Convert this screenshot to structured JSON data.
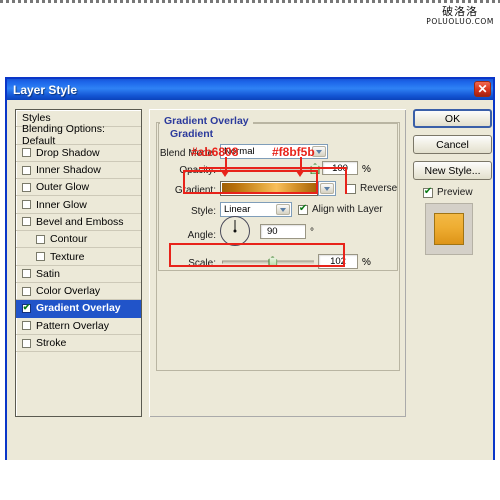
{
  "watermark": {
    "cn": "破洛洛",
    "en": "POLUOLUO.COM"
  },
  "dialog": {
    "title": "Layer Style",
    "close_icon": "close-icon"
  },
  "styles_list": [
    {
      "label": "Styles",
      "type": "header",
      "checked": false
    },
    {
      "label": "Blending Options: Default",
      "type": "header",
      "checked": false
    },
    {
      "label": "Drop Shadow",
      "type": "check",
      "checked": false
    },
    {
      "label": "Inner Shadow",
      "type": "check",
      "checked": false
    },
    {
      "label": "Outer Glow",
      "type": "check",
      "checked": false
    },
    {
      "label": "Inner Glow",
      "type": "check",
      "checked": false
    },
    {
      "label": "Bevel and Emboss",
      "type": "check",
      "checked": false
    },
    {
      "label": "Contour",
      "type": "subcheck",
      "checked": false
    },
    {
      "label": "Texture",
      "type": "subcheck",
      "checked": false
    },
    {
      "label": "Satin",
      "type": "check",
      "checked": false
    },
    {
      "label": "Color Overlay",
      "type": "check",
      "checked": false
    },
    {
      "label": "Gradient Overlay",
      "type": "check",
      "checked": true,
      "selected": true
    },
    {
      "label": "Pattern Overlay",
      "type": "check",
      "checked": false
    },
    {
      "label": "Stroke",
      "type": "check",
      "checked": false
    }
  ],
  "panel": {
    "title": "Gradient Overlay",
    "group_title": "Gradient",
    "blend_mode": {
      "label": "Blend Mode:",
      "value": "Normal"
    },
    "opacity": {
      "label": "Opacity:",
      "value": "100",
      "unit": "%",
      "slider_pct": 100
    },
    "gradient": {
      "label": "Gradient:",
      "dither_arrow": "chevron-down-icon"
    },
    "reverse": {
      "label": "Reverse",
      "checked": false
    },
    "style": {
      "label": "Style:",
      "value": "Linear"
    },
    "align": {
      "label": "Align with Layer",
      "checked": true
    },
    "angle": {
      "label": "Angle:",
      "value": "90",
      "unit": "°"
    },
    "scale": {
      "label": "Scale:",
      "value": "102",
      "unit": "%",
      "slider_pct": 55
    }
  },
  "buttons": {
    "ok": "OK",
    "cancel": "Cancel",
    "new_style": "New Style...",
    "preview": {
      "label": "Preview",
      "checked": true
    }
  },
  "annotations": {
    "color_start": "#ab6808",
    "color_end": "#f8bf5b",
    "highlight_color": "#e8231a"
  },
  "colors": {
    "gradient_start": "#ab6808",
    "gradient_mid": "#f8bf5b",
    "gradient_end": "#ab6808",
    "swatch_start": "#f0b33f",
    "swatch_end": "#dd9418",
    "titlebar": "#1b63e8"
  }
}
